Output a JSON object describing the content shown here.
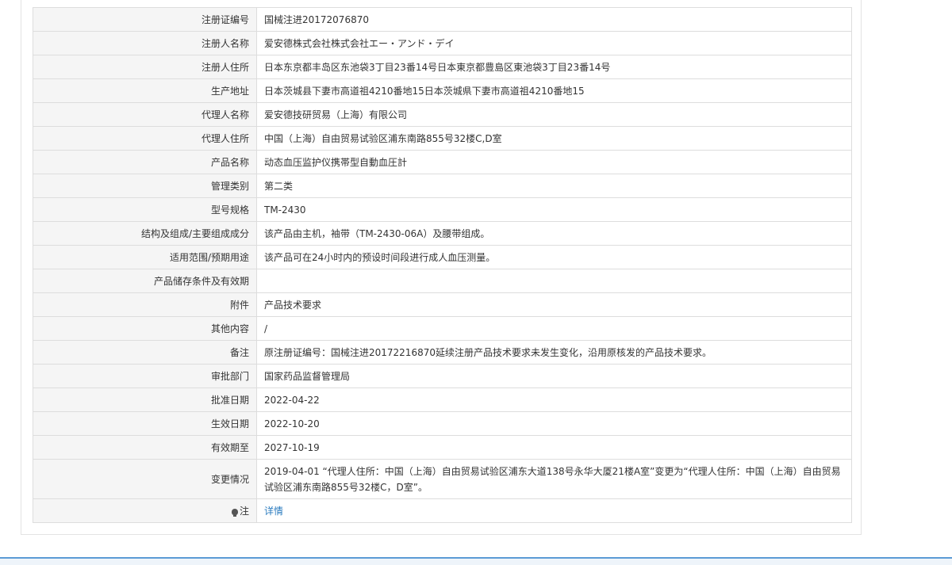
{
  "rows": [
    {
      "label": "注册证编号",
      "value": "国械注进20172076870"
    },
    {
      "label": "注册人名称",
      "value": "爱安德株式会社株式会社エー・アンド・デイ"
    },
    {
      "label": "注册人住所",
      "value": "日本东京都丰岛区东池袋3丁目23番14号日本東京都豊島区東池袋3丁目23番14号"
    },
    {
      "label": "生产地址",
      "value": "日本茨城县下妻市高道祖4210番地15日本茨城県下妻市高道祖4210番地15"
    },
    {
      "label": "代理人名称",
      "value": "爱安德技研贸易（上海）有限公司"
    },
    {
      "label": "代理人住所",
      "value": "中国（上海）自由贸易试验区浦东南路855号32楼C,D室"
    },
    {
      "label": "产品名称",
      "value": "动态血压监护仪携帯型自動血圧計"
    },
    {
      "label": "管理类别",
      "value": "第二类"
    },
    {
      "label": "型号规格",
      "value": "TM-2430"
    },
    {
      "label": "结构及组成/主要组成成分",
      "value": "该产品由主机，袖带（TM-2430-06A）及腰带组成。"
    },
    {
      "label": "适用范围/预期用途",
      "value": "该产品可在24小时内的预设时间段进行成人血压测量。"
    },
    {
      "label": "产品储存条件及有效期",
      "value": ""
    },
    {
      "label": "附件",
      "value": "产品技术要求"
    },
    {
      "label": "其他内容",
      "value": "/"
    },
    {
      "label": "备注",
      "value": "原注册证编号：国械注进20172216870延续注册产品技术要求未发生变化，沿用原核发的产品技术要求。"
    },
    {
      "label": "审批部门",
      "value": "国家药品监督管理局"
    },
    {
      "label": "批准日期",
      "value": "2022-04-22"
    },
    {
      "label": "生效日期",
      "value": "2022-10-20"
    },
    {
      "label": "有效期至",
      "value": "2027-10-19"
    },
    {
      "label": "变更情况",
      "value": "2019-04-01 “代理人住所：中国（上海）自由贸易试验区浦东大道138号永华大厦21楼A室”变更为“代理人住所：中国（上海）自由贸易试验区浦东南路855号32楼C，D室”。"
    }
  ],
  "note": {
    "icon": "lightbulb-icon",
    "label": "注",
    "link_text": "详情"
  },
  "colors": {
    "label_bg": "#f5f5f5",
    "border": "#dddddd",
    "link": "#2a7bbf",
    "accent_bar": "#5b9bd5"
  }
}
